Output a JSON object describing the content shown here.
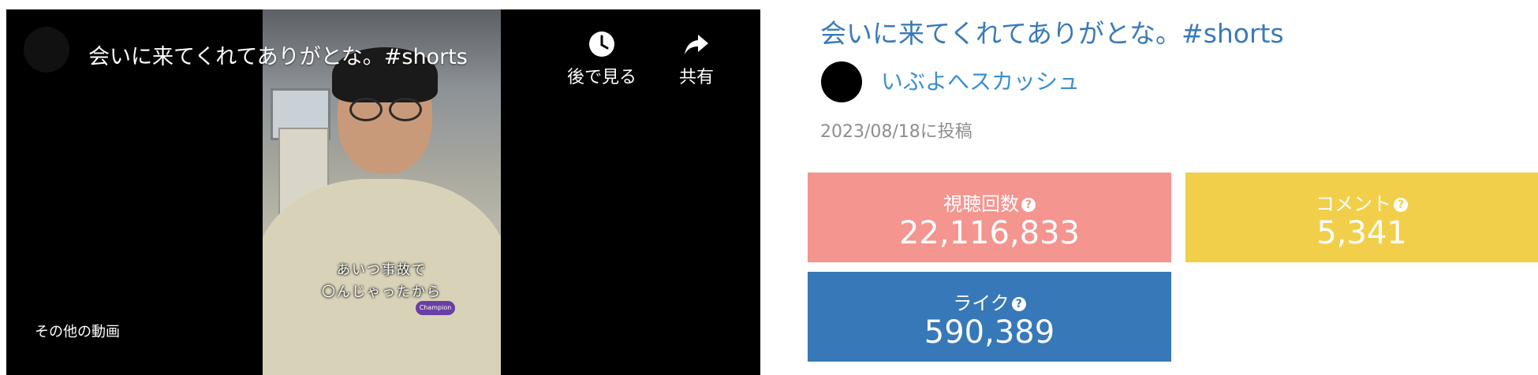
{
  "player": {
    "title": "会いに来てくれてありがとな。#shorts",
    "watch_later_label": "後で見る",
    "share_label": "共有",
    "more_videos_label": "その他の動画",
    "subtitle_line1": "あいつ事故で",
    "subtitle_line2": "〇んじゃったから",
    "icons": [
      "clock-icon",
      "share-arrow-icon"
    ]
  },
  "info": {
    "title": "会いに来てくれてありがとな。#shorts",
    "channel_name": "いぶよへスカッシュ",
    "posted_date": "2023/08/18に投稿"
  },
  "stats": {
    "views": {
      "label": "視聴回数",
      "value": "22,116,833",
      "color": "#f4958f"
    },
    "comments": {
      "label": "コメント",
      "value": "5,341",
      "color": "#f2cf4a"
    },
    "likes": {
      "label": "ライク",
      "value": "590,389",
      "color": "#3778b8"
    },
    "help_glyph": "?"
  },
  "colors": {
    "title_link": "#3a7ab8",
    "channel_link": "#3a8fd0",
    "muted_text": "#8e8e8e"
  }
}
